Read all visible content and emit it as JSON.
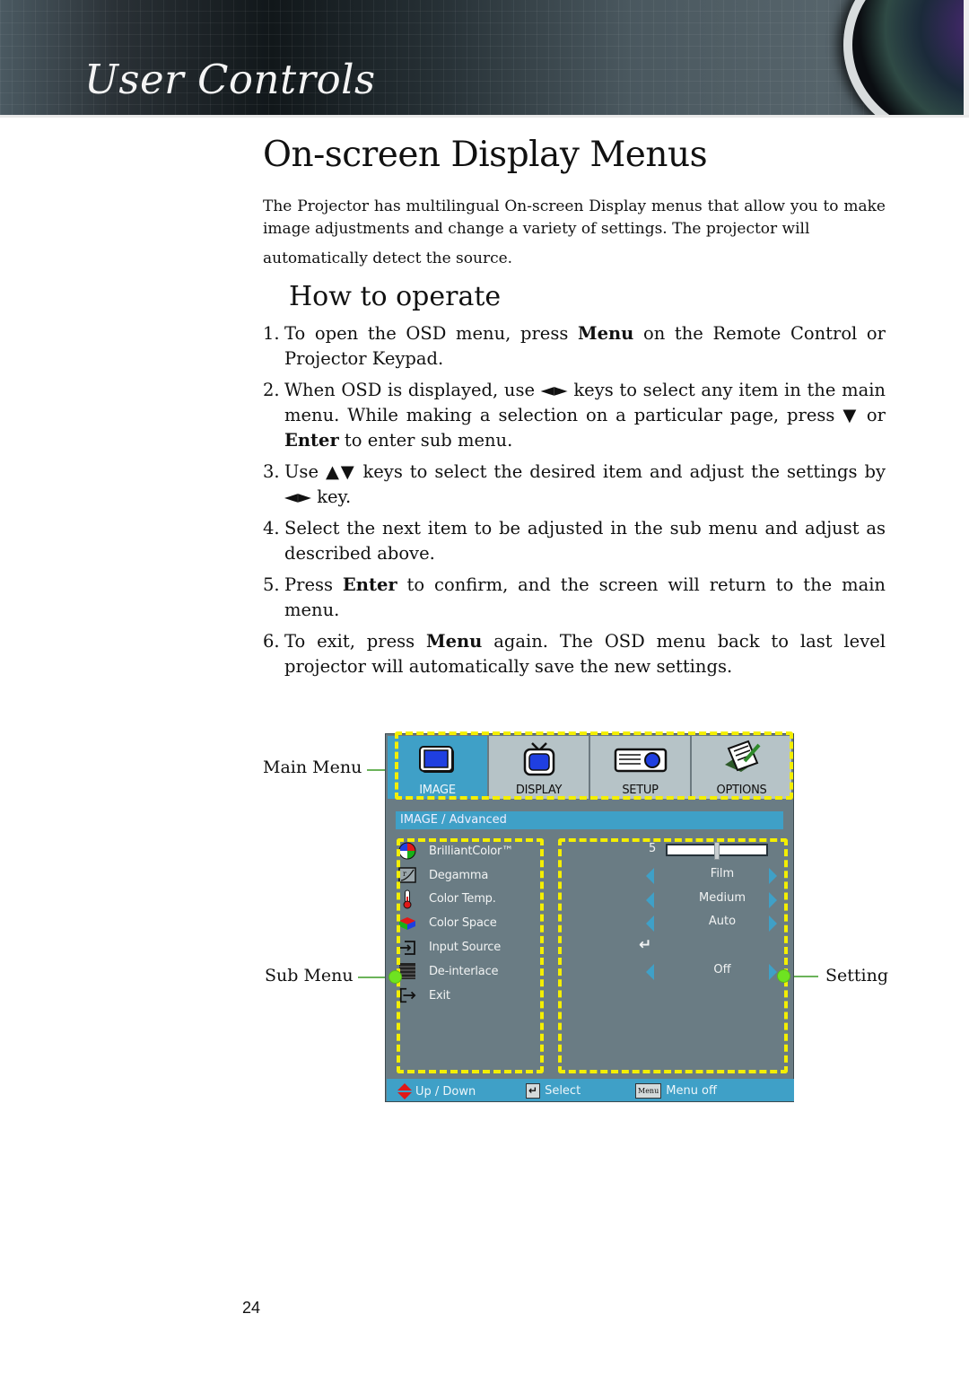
{
  "header": {
    "section_title": "User Controls"
  },
  "page": {
    "title": "On-screen Display Menus",
    "intro_line1": "The Projector has multilingual On-screen Display menus that allow you to make image adjustments and change a variety of settings. The projector will",
    "intro_line2": "automatically detect the source.",
    "subtitle": "How to operate",
    "page_number": "24"
  },
  "steps": [
    {
      "num": "1.",
      "parts": [
        "To open the OSD menu, press ",
        "Menu",
        " on the Remote Control or Projector Keypad."
      ]
    },
    {
      "num": "2.",
      "parts": [
        "When OSD is displayed, use ◄► keys to select any item in the main menu. While making a selection on a particular page, press ▼ or ",
        "Enter",
        " to enter sub menu."
      ]
    },
    {
      "num": "3.",
      "parts": [
        "Use ▲▼ keys to select the desired item and adjust the settings by ◄► key.",
        "",
        ""
      ]
    },
    {
      "num": "4.",
      "parts": [
        "Select the next item to be adjusted in the sub menu and adjust as described above.",
        "",
        ""
      ]
    },
    {
      "num": "5.",
      "parts": [
        "Press ",
        "Enter",
        " to confirm, and the screen will return to the main menu."
      ]
    },
    {
      "num": "6.",
      "parts": [
        "To exit, press ",
        "Menu",
        " again. The OSD menu back to last level projector will automatically save the new settings."
      ]
    }
  ],
  "callouts": {
    "main_menu": "Main Menu",
    "sub_menu": "Sub Menu",
    "setting": "Setting"
  },
  "osd": {
    "tabs": [
      {
        "label": "IMAGE",
        "icon": "monitor-icon",
        "active": true
      },
      {
        "label": "DISPLAY",
        "icon": "tv-icon",
        "active": false
      },
      {
        "label": "SETUP",
        "icon": "projector-icon",
        "active": false
      },
      {
        "label": "OPTIONS",
        "icon": "notepad-icon",
        "active": false
      }
    ],
    "breadcrumb": "IMAGE / Advanced",
    "items": [
      {
        "label": "BrilliantColor™",
        "icon": "color-wheel-icon"
      },
      {
        "label": "Degamma",
        "icon": "gamma-curve-icon"
      },
      {
        "label": "Color Temp.",
        "icon": "thermometer-icon"
      },
      {
        "label": "Color Space",
        "icon": "color-cube-icon"
      },
      {
        "label": "Input Source",
        "icon": "input-source-icon"
      },
      {
        "label": "De-interlace",
        "icon": "deinterlace-icon"
      },
      {
        "label": "Exit",
        "icon": "exit-icon"
      }
    ],
    "values": {
      "brilliantcolor": {
        "value": "5",
        "slider_fraction": 0.5
      },
      "degamma": "Film",
      "color_temp": "Medium",
      "color_space": "Auto",
      "input_source": "↵",
      "deinterlace": "Off"
    },
    "footer": {
      "up_down": "Up / Down",
      "select": "Select",
      "menu_key": "Menu",
      "menu_off": "Menu off"
    },
    "colors": {
      "accent": "#3fa0c7",
      "panel": "#6a7c84",
      "highlight_dash": "#f4ef00",
      "callout_dot": "#6ee321"
    }
  }
}
